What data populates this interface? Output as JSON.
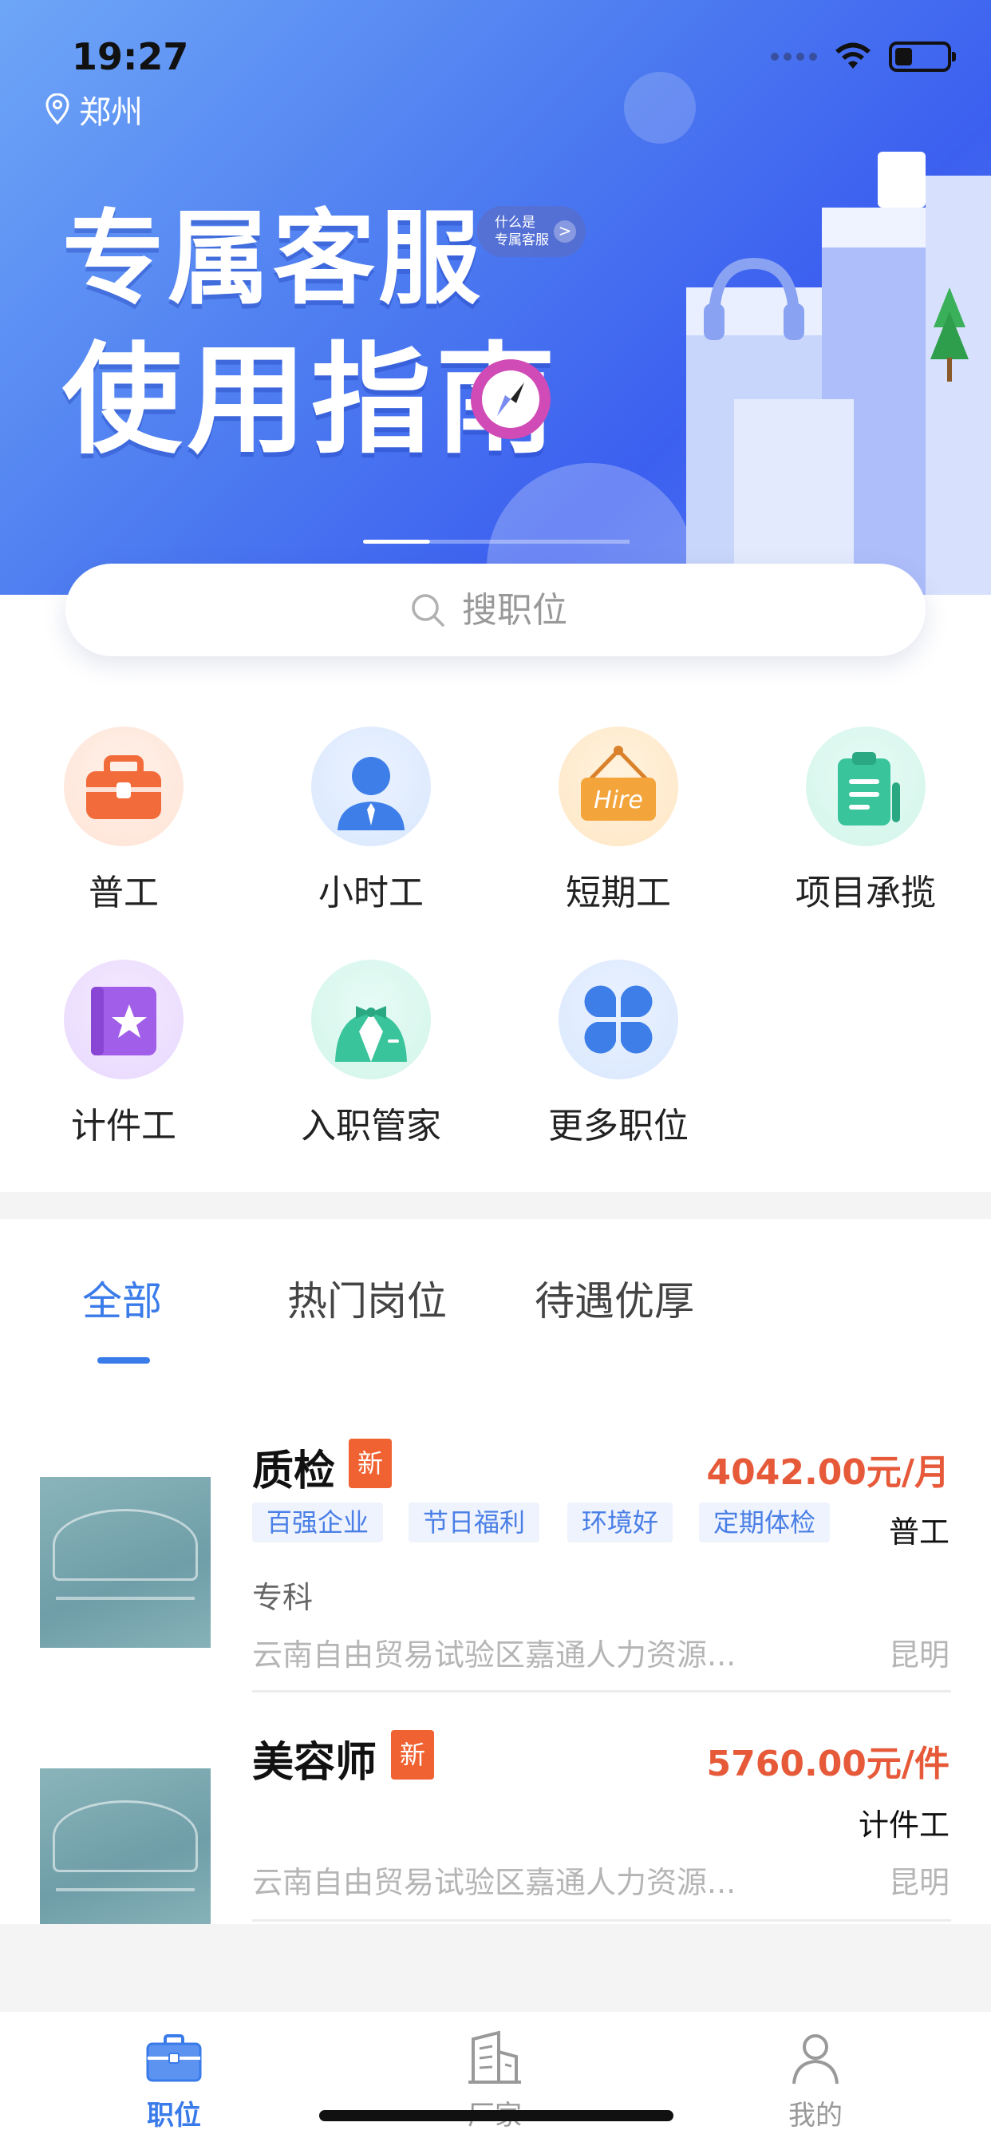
{
  "status_bar": {
    "time": "19:27"
  },
  "location": {
    "city": "郑州"
  },
  "banner": {
    "title_line1": "专属客服",
    "title_line2": "使用指南",
    "chip_line1": "什么是",
    "chip_line2": "专属客服",
    "chip_arrow": ">"
  },
  "search": {
    "placeholder": "搜职位"
  },
  "categories": [
    {
      "label": "普工",
      "icon": "toolbox-icon",
      "color": "#f26b3a"
    },
    {
      "label": "小时工",
      "icon": "person-icon",
      "color": "#3d7ee8"
    },
    {
      "label": "短期工",
      "icon": "hire-sign-icon",
      "color": "#f3a43a"
    },
    {
      "label": "项目承揽",
      "icon": "clipboard-icon",
      "color": "#39c49b"
    },
    {
      "label": "计件工",
      "icon": "star-book-icon",
      "color": "#a15ee8"
    },
    {
      "label": "入职管家",
      "icon": "butler-icon",
      "color": "#39c49b"
    },
    {
      "label": "更多职位",
      "icon": "clover-icon",
      "color": "#3d7ee8"
    }
  ],
  "tabs": [
    {
      "label": "全部",
      "active": true
    },
    {
      "label": "热门岗位",
      "active": false
    },
    {
      "label": "待遇优厚",
      "active": false
    }
  ],
  "jobs": [
    {
      "title": "质检",
      "badge": "新",
      "salary": "4042.00元/月",
      "tags": [
        "百强企业",
        "节日福利",
        "环境好",
        "定期体检"
      ],
      "type": "普工",
      "education": "专科",
      "company": "云南自由贸易试验区嘉通人力资源...",
      "city": "昆明"
    },
    {
      "title": "美容师",
      "badge": "新",
      "salary": "5760.00元/件",
      "tags": [],
      "type": "计件工",
      "education": "",
      "company": "云南自由贸易试验区嘉通人力资源...",
      "city": "昆明"
    }
  ],
  "bottom_nav": [
    {
      "label": "职位",
      "icon": "briefcase-icon",
      "active": true
    },
    {
      "label": "厂家",
      "icon": "building-icon",
      "active": false
    },
    {
      "label": "我的",
      "icon": "user-icon",
      "active": false
    }
  ],
  "colors": {
    "accent": "#3a7bea",
    "salary": "#e65a3a",
    "badge": "#f06232"
  }
}
